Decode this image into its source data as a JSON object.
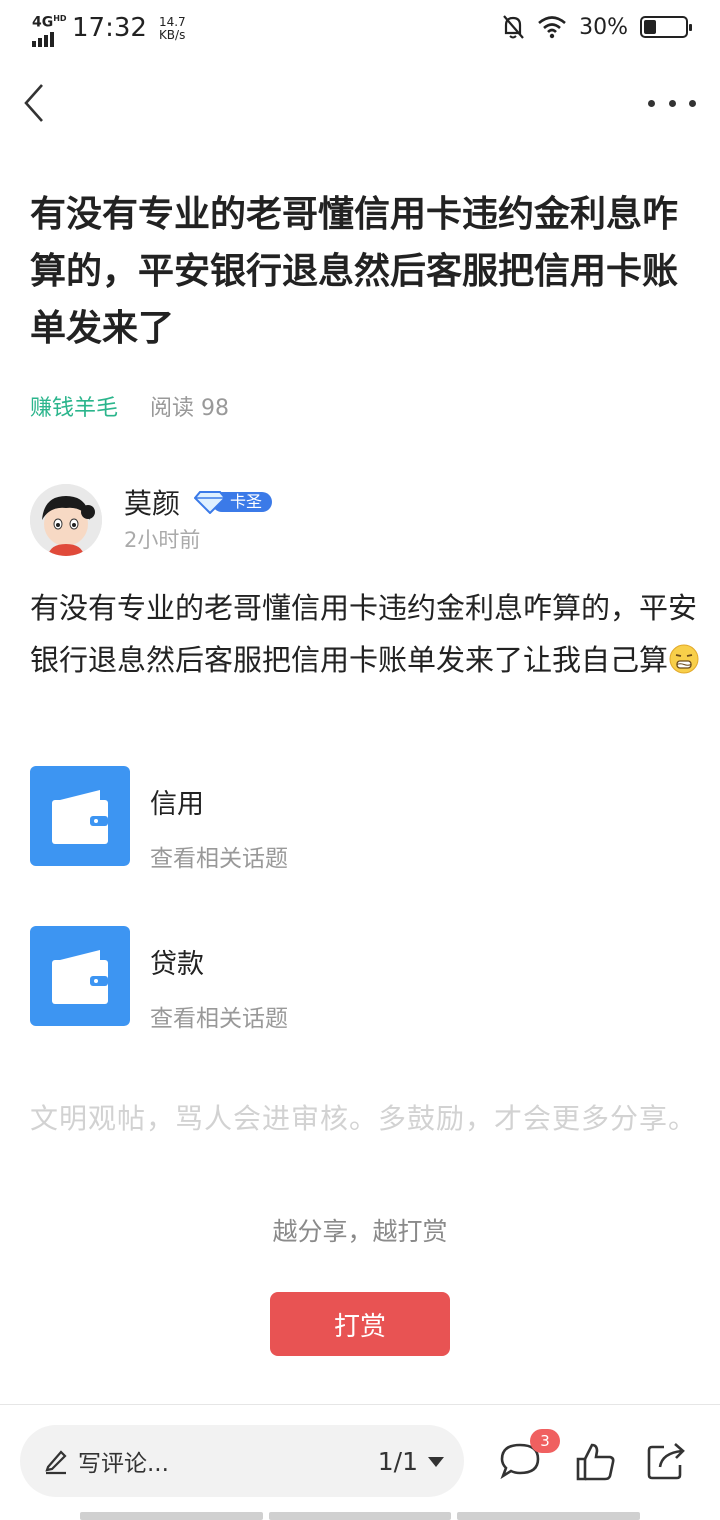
{
  "status_bar": {
    "network": "4G",
    "network_sup": "HD",
    "time": "17:32",
    "speed_value": "14.7",
    "speed_unit": "KB/s",
    "battery": "30%",
    "battery_level": 0.3
  },
  "nav": {
    "back_icon": "chevron-left-icon",
    "more_icon": "more-dots-icon"
  },
  "post": {
    "title": "有没有专业的老哥懂信用卡违约金利息咋算的，平安银行退息然后客服把信用卡账单发来了",
    "topic": "赚钱羊毛",
    "read_label": "阅读",
    "read_count": "98",
    "author": {
      "name": "莫颜",
      "badge": "卡圣",
      "time": "2小时前"
    },
    "body": "有没有专业的老哥懂信用卡违约金利息咋算的，平安银行退息然后客服把信用卡账单发来了让我自己算",
    "emoji": "grimace-emoji"
  },
  "topics": [
    {
      "name": "信用",
      "sub": "查看相关话题",
      "icon": "wallet-icon"
    },
    {
      "name": "贷款",
      "sub": "查看相关话题",
      "icon": "wallet-icon"
    }
  ],
  "comment_hint": "文明观帖，骂人会进审核。多鼓励，才会更多分享。",
  "reward": {
    "hint": "越分享，越打赏",
    "button": "打赏"
  },
  "bottom_bar": {
    "comment_placeholder": "写评论...",
    "page": "1/1",
    "comment_count": "3",
    "icons": [
      "comment-icon",
      "like-icon",
      "share-icon"
    ]
  },
  "colors": {
    "accent_green": "#2bb58c",
    "reward_red": "#e85353",
    "topic_blue": "#3d95f2",
    "badge_blue": "#3b7ae8"
  }
}
